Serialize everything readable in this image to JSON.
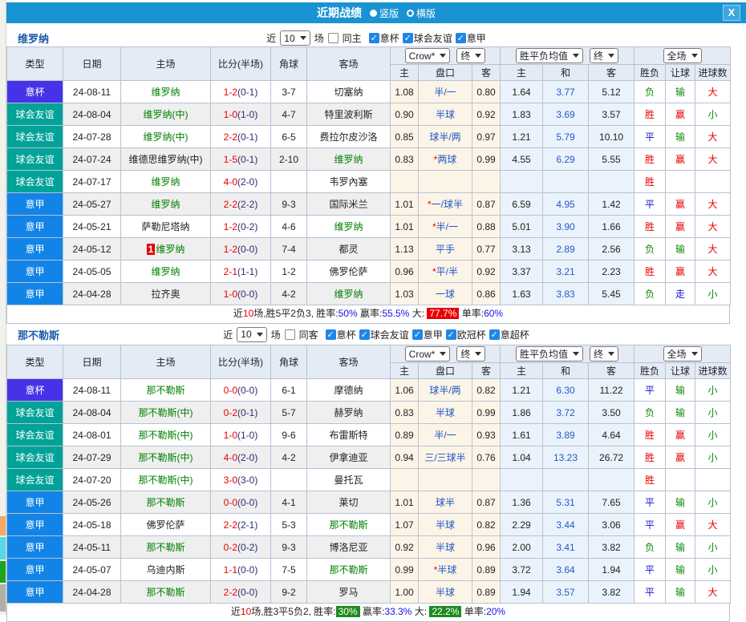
{
  "dialog": {
    "title": "近期战绩",
    "view_modes": [
      {
        "label": "竖版",
        "selected": true
      },
      {
        "label": "横版",
        "selected": false
      }
    ],
    "close_label": "X"
  },
  "table_header": {
    "type": "类型",
    "date": "日期",
    "home": "主场",
    "score": "比分(半场)",
    "corner": "角球",
    "away": "客场",
    "bookmaker_select": "Crow*",
    "final_select1": "终",
    "odds_select": "胜平负均值",
    "final_select2": "终",
    "scope_select": "全场",
    "ah_home": "主",
    "ah_line": "盘口",
    "ah_away": "客",
    "o_home": "主",
    "o_draw": "和",
    "o_away": "客",
    "res_wdl": "胜负",
    "res_handicap": "让球",
    "res_goals": "进球数"
  },
  "type_colors": {
    "意杯": "#4633e8",
    "球会友谊": "#01a297",
    "意甲": "#1284e7"
  },
  "result_colors": {
    "胜": "#e80000",
    "赢": "#e80000",
    "大": "#e80000",
    "平": "#1414cc",
    "走": "#1414cc",
    "负": "#0a8a0a",
    "输": "#0a8a0a",
    "小": "#0a8a0a"
  },
  "sections": [
    {
      "team": "维罗纳",
      "controls": {
        "near": "近",
        "count": "10",
        "games": "场",
        "same_label": "同主",
        "same_checked": false,
        "filters": [
          {
            "label": "意杯",
            "checked": true
          },
          {
            "label": "球会友谊",
            "checked": true
          },
          {
            "label": "意甲",
            "checked": true
          }
        ]
      },
      "rows": [
        {
          "type": "意杯",
          "date": "24-08-11",
          "home": {
            "name": "维罗纳",
            "hl": true,
            "badge": ""
          },
          "score": {
            "ft": "1-2",
            "ht": "(0-1)"
          },
          "corner": "3-7",
          "away": {
            "name": "切塞纳",
            "hl": false
          },
          "ah": {
            "home": "1.08",
            "line": "半/一",
            "away": "0.80"
          },
          "odds": {
            "home": "1.64",
            "draw": "3.77",
            "away": "5.12"
          },
          "result": {
            "wdl": "负",
            "handicap": "输",
            "goals": "大"
          }
        },
        {
          "type": "球会友谊",
          "date": "24-08-04",
          "home": {
            "name": "维罗纳(中)",
            "hl": true,
            "badge": ""
          },
          "score": {
            "ft": "1-0",
            "ht": "(1-0)"
          },
          "corner": "4-7",
          "away": {
            "name": "特里波利斯",
            "hl": false
          },
          "ah": {
            "home": "0.90",
            "line": "半球",
            "away": "0.92"
          },
          "odds": {
            "home": "1.83",
            "draw": "3.69",
            "away": "3.57"
          },
          "result": {
            "wdl": "胜",
            "handicap": "赢",
            "goals": "小"
          }
        },
        {
          "type": "球会友谊",
          "date": "24-07-28",
          "home": {
            "name": "维罗纳(中)",
            "hl": true,
            "badge": ""
          },
          "score": {
            "ft": "2-2",
            "ht": "(0-1)"
          },
          "corner": "6-5",
          "away": {
            "name": "费拉尔皮沙洛",
            "hl": false
          },
          "ah": {
            "home": "0.85",
            "line": "球半/两",
            "away": "0.97"
          },
          "odds": {
            "home": "1.21",
            "draw": "5.79",
            "away": "10.10"
          },
          "result": {
            "wdl": "平",
            "handicap": "输",
            "goals": "大"
          }
        },
        {
          "type": "球会友谊",
          "date": "24-07-24",
          "home": {
            "name": "维德思维罗纳(中)",
            "hl": false,
            "badge": ""
          },
          "score": {
            "ft": "1-5",
            "ht": "(0-1)"
          },
          "corner": "2-10",
          "away": {
            "name": "维罗纳",
            "hl": true
          },
          "ah": {
            "home": "0.83",
            "line": "*两球",
            "away": "0.99"
          },
          "odds": {
            "home": "4.55",
            "draw": "6.29",
            "away": "5.55"
          },
          "result": {
            "wdl": "胜",
            "handicap": "赢",
            "goals": "大"
          }
        },
        {
          "type": "球会友谊",
          "date": "24-07-17",
          "home": {
            "name": "维罗纳",
            "hl": true,
            "badge": ""
          },
          "score": {
            "ft": "4-0",
            "ht": "(2-0)"
          },
          "corner": "",
          "away": {
            "name": "韦罗內塞",
            "hl": false
          },
          "ah": {
            "home": "",
            "line": "",
            "away": ""
          },
          "odds": {
            "home": "",
            "draw": "",
            "away": ""
          },
          "result": {
            "wdl": "胜",
            "handicap": "",
            "goals": ""
          }
        },
        {
          "type": "意甲",
          "date": "24-05-27",
          "home": {
            "name": "维罗纳",
            "hl": true,
            "badge": ""
          },
          "score": {
            "ft": "2-2",
            "ht": "(2-2)"
          },
          "corner": "9-3",
          "away": {
            "name": "国际米兰",
            "hl": false
          },
          "ah": {
            "home": "1.01",
            "line": "*一/球半",
            "away": "0.87"
          },
          "odds": {
            "home": "6.59",
            "draw": "4.95",
            "away": "1.42"
          },
          "result": {
            "wdl": "平",
            "handicap": "赢",
            "goals": "大"
          }
        },
        {
          "type": "意甲",
          "date": "24-05-21",
          "home": {
            "name": "萨勒尼塔纳",
            "hl": false,
            "badge": ""
          },
          "score": {
            "ft": "1-2",
            "ht": "(0-2)"
          },
          "corner": "4-6",
          "away": {
            "name": "维罗纳",
            "hl": true
          },
          "ah": {
            "home": "1.01",
            "line": "*半/一",
            "away": "0.88"
          },
          "odds": {
            "home": "5.01",
            "draw": "3.90",
            "away": "1.66"
          },
          "result": {
            "wdl": "胜",
            "handicap": "赢",
            "goals": "大"
          }
        },
        {
          "type": "意甲",
          "date": "24-05-12",
          "home": {
            "name": "维罗纳",
            "hl": true,
            "badge": "1"
          },
          "score": {
            "ft": "1-2",
            "ht": "(0-0)"
          },
          "corner": "7-4",
          "away": {
            "name": "都灵",
            "hl": false
          },
          "ah": {
            "home": "1.13",
            "line": "平手",
            "away": "0.77"
          },
          "odds": {
            "home": "3.13",
            "draw": "2.89",
            "away": "2.56"
          },
          "result": {
            "wdl": "负",
            "handicap": "输",
            "goals": "大"
          }
        },
        {
          "type": "意甲",
          "date": "24-05-05",
          "home": {
            "name": "维罗纳",
            "hl": true,
            "badge": ""
          },
          "score": {
            "ft": "2-1",
            "ht": "(1-1)"
          },
          "corner": "1-2",
          "away": {
            "name": "佛罗伦萨",
            "hl": false
          },
          "ah": {
            "home": "0.96",
            "line": "*平/半",
            "away": "0.92"
          },
          "odds": {
            "home": "3.37",
            "draw": "3.21",
            "away": "2.23"
          },
          "result": {
            "wdl": "胜",
            "handicap": "赢",
            "goals": "大"
          }
        },
        {
          "type": "意甲",
          "date": "24-04-28",
          "home": {
            "name": "拉齐奥",
            "hl": false,
            "badge": ""
          },
          "score": {
            "ft": "1-0",
            "ht": "(0-0)"
          },
          "corner": "4-2",
          "away": {
            "name": "维罗纳",
            "hl": true
          },
          "ah": {
            "home": "1.03",
            "line": "一球",
            "away": "0.86"
          },
          "odds": {
            "home": "1.63",
            "draw": "3.83",
            "away": "5.45"
          },
          "result": {
            "wdl": "负",
            "handicap": "走",
            "goals": "小"
          }
        }
      ],
      "summary": [
        {
          "text": "近",
          "style": "plain"
        },
        {
          "text": "10",
          "style": "red"
        },
        {
          "text": "场,胜5平2负3, 胜率:",
          "style": "plain"
        },
        {
          "text": "50%",
          "style": "blue"
        },
        {
          "text": " 赢率:",
          "style": "plain"
        },
        {
          "text": "55.5%",
          "style": "blue"
        },
        {
          "text": " 大: ",
          "style": "plain"
        },
        {
          "text": "77.7%",
          "style": "badge-red"
        },
        {
          "text": " 单率:",
          "style": "plain"
        },
        {
          "text": "60%",
          "style": "blue"
        }
      ]
    },
    {
      "team": "那不勒斯",
      "controls": {
        "near": "近",
        "count": "10",
        "games": "场",
        "same_label": "同客",
        "same_checked": false,
        "filters": [
          {
            "label": "意杯",
            "checked": true
          },
          {
            "label": "球会友谊",
            "checked": true
          },
          {
            "label": "意甲",
            "checked": true
          },
          {
            "label": "欧冠杯",
            "checked": true
          },
          {
            "label": "意超杯",
            "checked": true
          }
        ]
      },
      "rows": [
        {
          "type": "意杯",
          "date": "24-08-11",
          "home": {
            "name": "那不勒斯",
            "hl": true,
            "badge": ""
          },
          "score": {
            "ft": "0-0",
            "ht": "(0-0)"
          },
          "corner": "6-1",
          "away": {
            "name": "摩德纳",
            "hl": false
          },
          "ah": {
            "home": "1.06",
            "line": "球半/两",
            "away": "0.82"
          },
          "odds": {
            "home": "1.21",
            "draw": "6.30",
            "away": "11.22"
          },
          "result": {
            "wdl": "平",
            "handicap": "输",
            "goals": "小"
          }
        },
        {
          "type": "球会友谊",
          "date": "24-08-04",
          "home": {
            "name": "那不勒斯(中)",
            "hl": true,
            "badge": ""
          },
          "score": {
            "ft": "0-2",
            "ht": "(0-1)"
          },
          "corner": "5-7",
          "away": {
            "name": "赫罗纳",
            "hl": false
          },
          "ah": {
            "home": "0.83",
            "line": "半球",
            "away": "0.99"
          },
          "odds": {
            "home": "1.86",
            "draw": "3.72",
            "away": "3.50"
          },
          "result": {
            "wdl": "负",
            "handicap": "输",
            "goals": "小"
          }
        },
        {
          "type": "球会友谊",
          "date": "24-08-01",
          "home": {
            "name": "那不勒斯(中)",
            "hl": true,
            "badge": ""
          },
          "score": {
            "ft": "1-0",
            "ht": "(1-0)"
          },
          "corner": "9-6",
          "away": {
            "name": "布雷斯特",
            "hl": false
          },
          "ah": {
            "home": "0.89",
            "line": "半/一",
            "away": "0.93"
          },
          "odds": {
            "home": "1.61",
            "draw": "3.89",
            "away": "4.64"
          },
          "result": {
            "wdl": "胜",
            "handicap": "赢",
            "goals": "小"
          }
        },
        {
          "type": "球会友谊",
          "date": "24-07-29",
          "home": {
            "name": "那不勒斯(中)",
            "hl": true,
            "badge": ""
          },
          "score": {
            "ft": "4-0",
            "ht": "(2-0)"
          },
          "corner": "4-2",
          "away": {
            "name": "伊拿迪亚",
            "hl": false
          },
          "ah": {
            "home": "0.94",
            "line": "三/三球半",
            "away": "0.76"
          },
          "odds": {
            "home": "1.04",
            "draw": "13.23",
            "away": "26.72"
          },
          "result": {
            "wdl": "胜",
            "handicap": "赢",
            "goals": "小"
          }
        },
        {
          "type": "球会友谊",
          "date": "24-07-20",
          "home": {
            "name": "那不勒斯(中)",
            "hl": true,
            "badge": ""
          },
          "score": {
            "ft": "3-0",
            "ht": "(3-0)"
          },
          "corner": "",
          "away": {
            "name": "曼托瓦",
            "hl": false
          },
          "ah": {
            "home": "",
            "line": "",
            "away": ""
          },
          "odds": {
            "home": "",
            "draw": "",
            "away": ""
          },
          "result": {
            "wdl": "胜",
            "handicap": "",
            "goals": ""
          }
        },
        {
          "type": "意甲",
          "date": "24-05-26",
          "home": {
            "name": "那不勒斯",
            "hl": true,
            "badge": ""
          },
          "score": {
            "ft": "0-0",
            "ht": "(0-0)"
          },
          "corner": "4-1",
          "away": {
            "name": "莱切",
            "hl": false
          },
          "ah": {
            "home": "1.01",
            "line": "球半",
            "away": "0.87"
          },
          "odds": {
            "home": "1.36",
            "draw": "5.31",
            "away": "7.65"
          },
          "result": {
            "wdl": "平",
            "handicap": "输",
            "goals": "小"
          }
        },
        {
          "type": "意甲",
          "date": "24-05-18",
          "home": {
            "name": "佛罗伦萨",
            "hl": false,
            "badge": ""
          },
          "score": {
            "ft": "2-2",
            "ht": "(2-1)"
          },
          "corner": "5-3",
          "away": {
            "name": "那不勒斯",
            "hl": true
          },
          "ah": {
            "home": "1.07",
            "line": "半球",
            "away": "0.82"
          },
          "odds": {
            "home": "2.29",
            "draw": "3.44",
            "away": "3.06"
          },
          "result": {
            "wdl": "平",
            "handicap": "赢",
            "goals": "大"
          }
        },
        {
          "type": "意甲",
          "date": "24-05-11",
          "home": {
            "name": "那不勒斯",
            "hl": true,
            "badge": ""
          },
          "score": {
            "ft": "0-2",
            "ht": "(0-2)"
          },
          "corner": "9-3",
          "away": {
            "name": "博洛尼亚",
            "hl": false
          },
          "ah": {
            "home": "0.92",
            "line": "半球",
            "away": "0.96"
          },
          "odds": {
            "home": "2.00",
            "draw": "3.41",
            "away": "3.82"
          },
          "result": {
            "wdl": "负",
            "handicap": "输",
            "goals": "小"
          }
        },
        {
          "type": "意甲",
          "date": "24-05-07",
          "home": {
            "name": "乌迪内斯",
            "hl": false,
            "badge": ""
          },
          "score": {
            "ft": "1-1",
            "ht": "(0-0)"
          },
          "corner": "7-5",
          "away": {
            "name": "那不勒斯",
            "hl": true
          },
          "ah": {
            "home": "0.99",
            "line": "*半球",
            "away": "0.89"
          },
          "odds": {
            "home": "3.72",
            "draw": "3.64",
            "away": "1.94"
          },
          "result": {
            "wdl": "平",
            "handicap": "输",
            "goals": "小"
          }
        },
        {
          "type": "意甲",
          "date": "24-04-28",
          "home": {
            "name": "那不勒斯",
            "hl": true,
            "badge": ""
          },
          "score": {
            "ft": "2-2",
            "ht": "(0-0)"
          },
          "corner": "9-2",
          "away": {
            "name": "罗马",
            "hl": false
          },
          "ah": {
            "home": "1.00",
            "line": "半球",
            "away": "0.89"
          },
          "odds": {
            "home": "1.94",
            "draw": "3.57",
            "away": "3.82"
          },
          "result": {
            "wdl": "平",
            "handicap": "输",
            "goals": "大"
          }
        }
      ],
      "summary": [
        {
          "text": "近",
          "style": "plain"
        },
        {
          "text": "10",
          "style": "red"
        },
        {
          "text": "场,胜3平5负2, 胜率:",
          "style": "plain"
        },
        {
          "text": "30%",
          "style": "badge-green"
        },
        {
          "text": " 赢率:",
          "style": "plain"
        },
        {
          "text": "33.3%",
          "style": "blue"
        },
        {
          "text": " 大: ",
          "style": "plain"
        },
        {
          "text": "22.2%",
          "style": "badge-green"
        },
        {
          "text": " 单率:",
          "style": "plain"
        },
        {
          "text": "20%",
          "style": "blue"
        }
      ]
    }
  ]
}
